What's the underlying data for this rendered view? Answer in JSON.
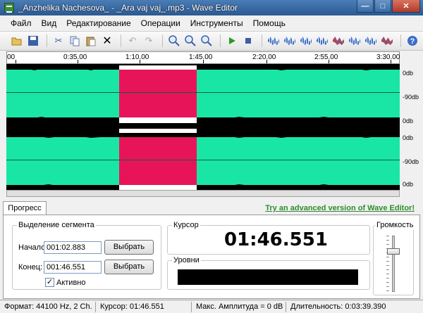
{
  "window": {
    "title": "_Anzhelika Nachesova_ - _Ara vaj vaj_.mp3 - Wave Editor",
    "controls": [
      "—",
      "□",
      "✕"
    ]
  },
  "menu": [
    "Файл",
    "Вид",
    "Редактирование",
    "Операции",
    "Инструменты",
    "Помощь"
  ],
  "toolbar": {
    "icons": [
      "open-icon",
      "save-icon",
      "cut-icon",
      "copy-icon",
      "paste-icon",
      "delete-icon",
      "undo-icon",
      "redo-icon",
      "zoom-in-icon",
      "zoom-out-icon",
      "zoom-fit-icon",
      "play-icon",
      "stop-icon",
      "amplify-icon",
      "normalize-icon",
      "fade-in-icon",
      "fade-out-icon",
      "silence-icon",
      "reverse-icon",
      "invert-icon",
      "insert-silence-icon",
      "help-icon"
    ]
  },
  "ruler": {
    "labels": [
      "00",
      "0:35.00",
      "1:10.00",
      "1:45.00",
      "2:20.00",
      "2:55.00",
      "3:30.00"
    ]
  },
  "db_scale": [
    "0db",
    "-90db",
    "0db",
    "0db",
    "-90db",
    "0db"
  ],
  "colors": {
    "wave": "#19e6a5",
    "selection": "#e8145a",
    "background": "#000000",
    "link": "#2e8b2e"
  },
  "tabs": {
    "progress": "Прогресс",
    "advanced_link": "Try an advanced version of Wave Editor!"
  },
  "segment": {
    "title": "Выделение сегмента",
    "start_label": "Начало:",
    "start_value": "001:02.883",
    "end_label": "Конец:",
    "end_value": "001:46.551",
    "select_button": "Выбрать",
    "active_label": "Активно",
    "active_checked": true
  },
  "cursor": {
    "title": "Курсор",
    "time": "01:46.551"
  },
  "levels": {
    "title": "Уровни"
  },
  "volume": {
    "title": "Громкость",
    "level": 0.75
  },
  "status": {
    "format": "Формат: 44100 Hz, 2 Ch.",
    "cursor": "Курсор: 01:46.551",
    "max_amp": "Макс. Амплитуда = 0 dB",
    "duration": "Длительность: 0:03:39.390"
  }
}
